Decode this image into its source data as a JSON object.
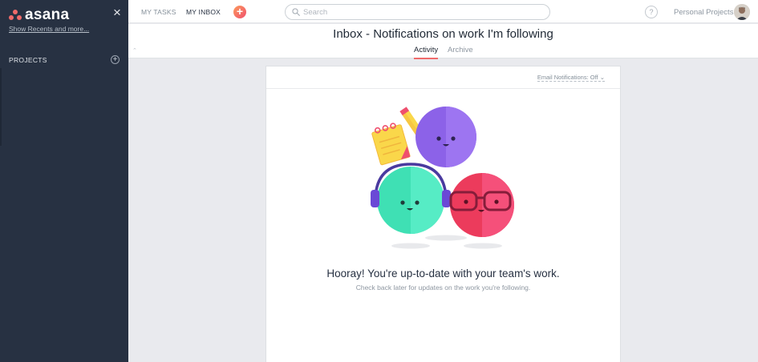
{
  "sidebar": {
    "brand": "asana",
    "show_recents": "Show Recents and more...",
    "projects_label": "PROJECTS",
    "add_symbol": "+",
    "close_symbol": "×"
  },
  "topbar": {
    "nav": [
      {
        "label": "MY TASKS"
      },
      {
        "label": "MY INBOX"
      }
    ],
    "add_symbol": "+",
    "search_placeholder": "Search",
    "help_symbol": "?",
    "org_name": "Personal Projects"
  },
  "header": {
    "title": "Inbox - Notifications on work I'm following",
    "tabs": [
      {
        "label": "Activity",
        "active": true
      },
      {
        "label": "Archive",
        "active": false
      }
    ]
  },
  "card": {
    "email_notifications": "Email Notifications: Off",
    "headline": "Hooray! You're up-to-date with your team's work.",
    "subtext": "Check back later for updates on the work you're following."
  },
  "icons": {
    "close": "close-icon",
    "add": "plus-icon",
    "search": "search-icon",
    "help": "help-icon",
    "collapse": "chevron-up-icon",
    "dropdown": "chevron-down-icon"
  },
  "colors": {
    "sidebar_bg": "#273142",
    "accent": "#f06a6a",
    "add_button": "#f5736b",
    "purple_character": "#8c62e8",
    "teal_character": "#3fe0b4",
    "red_character": "#ec3b5c",
    "notebook": "#fad74a"
  }
}
